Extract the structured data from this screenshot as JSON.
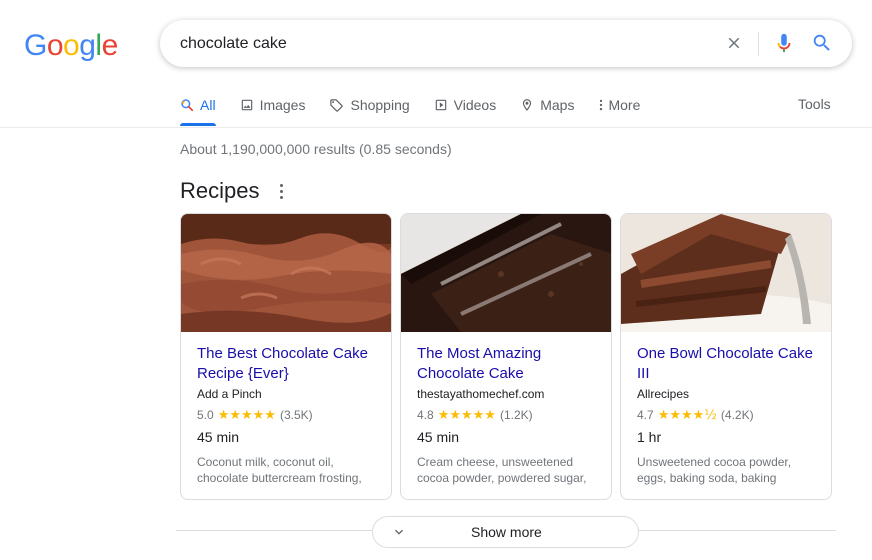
{
  "logo": {
    "letters": [
      "G",
      "o",
      "o",
      "g",
      "l",
      "e"
    ],
    "colors": [
      "#4285F4",
      "#EA4335",
      "#FBBC05",
      "#4285F4",
      "#34A853",
      "#EA4335"
    ]
  },
  "search": {
    "query": "chocolate cake",
    "clear_icon": "close-icon",
    "voice_icon": "microphone-icon",
    "search_icon": "search-icon"
  },
  "tabs": [
    {
      "label": "All",
      "icon": "search-icon",
      "active": true
    },
    {
      "label": "Images",
      "icon": "image-icon",
      "active": false
    },
    {
      "label": "Shopping",
      "icon": "tag-icon",
      "active": false
    },
    {
      "label": "Videos",
      "icon": "play-icon",
      "active": false
    },
    {
      "label": "Maps",
      "icon": "map-pin-icon",
      "active": false
    },
    {
      "label": "More",
      "icon": "more-vert-icon",
      "active": false
    }
  ],
  "tools_label": "Tools",
  "result_stats": "About 1,190,000,000 results (0.85 seconds)",
  "recipes": {
    "title": "Recipes",
    "cards": [
      {
        "title": "The Best Chocolate Cake Recipe {Ever}",
        "source": "Add a Pinch",
        "rating": "5.0",
        "stars": "★★★★★",
        "reviews": "(3.5K)",
        "time": "45 min",
        "ingredients": "Coconut milk, coconut oil, chocolate buttercream frosting,"
      },
      {
        "title": "The Most Amazing Chocolate Cake",
        "source": "thestayathomechef.com",
        "rating": "4.8",
        "stars": "★★★★★",
        "reviews": "(1.2K)",
        "time": "45 min",
        "ingredients": "Cream cheese, unsweetened cocoa powder, powdered sugar,"
      },
      {
        "title": "One Bowl Chocolate Cake III",
        "source": "Allrecipes",
        "rating": "4.7",
        "stars": "★★★★½",
        "reviews": "(4.2K)",
        "time": "1 hr",
        "ingredients": "Unsweetened cocoa powder, eggs, baking soda, baking"
      }
    ]
  },
  "show_more": {
    "label": "Show more"
  },
  "colors": {
    "link": "#1a0dab",
    "accent": "#1a73e8",
    "star": "#fbbc04",
    "muted": "#70757a"
  }
}
